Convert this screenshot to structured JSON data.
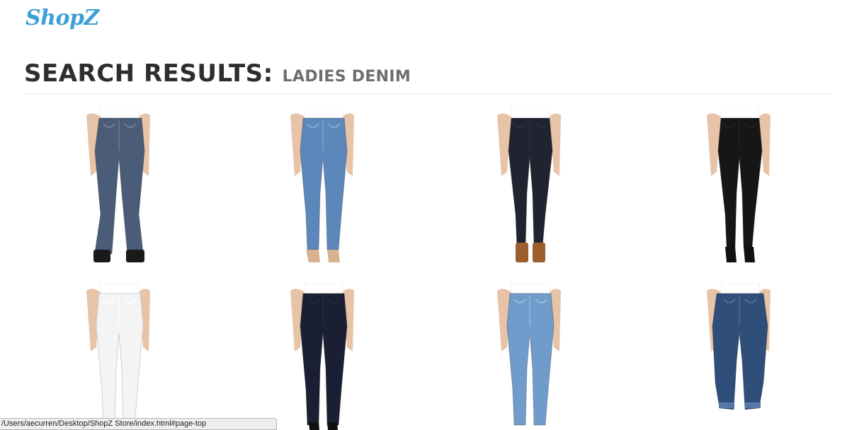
{
  "header": {
    "logo_text": "ShopZ"
  },
  "search": {
    "heading": "SEARCH RESULTS:",
    "query": "LADIES DENIM"
  },
  "products": [
    {
      "denim_color": "#4a5c77",
      "fade_color": "#7a8aa0",
      "shoe": "black-boots",
      "fit": "bootcut"
    },
    {
      "denim_color": "#5b87bb",
      "fade_color": "#8fb3da",
      "shoe": "nude-heels",
      "fit": "straight"
    },
    {
      "denim_color": "#1f2430",
      "fade_color": "#2c3342",
      "shoe": "brown-boots",
      "fit": "skinny"
    },
    {
      "denim_color": "#161616",
      "fade_color": "#262626",
      "shoe": "black-heels",
      "fit": "skinny"
    },
    {
      "denim_color": "#f4f4f4",
      "fade_color": "#ffffff",
      "shoe": "none",
      "fit": "straight"
    },
    {
      "denim_color": "#1b1f33",
      "fade_color": "#272c45",
      "shoe": "black-heels",
      "fit": "straight"
    },
    {
      "denim_color": "#6f9ccb",
      "fade_color": "#a2c2e2",
      "shoe": "none",
      "fit": "straight"
    },
    {
      "denim_color": "#2f4e7a",
      "fade_color": "#557aa8",
      "shoe": "none",
      "fit": "boyfriend"
    }
  ],
  "status_bar": {
    "url": "/Users/aecurren/Desktop/ShopZ Store/index.html#page-top"
  }
}
